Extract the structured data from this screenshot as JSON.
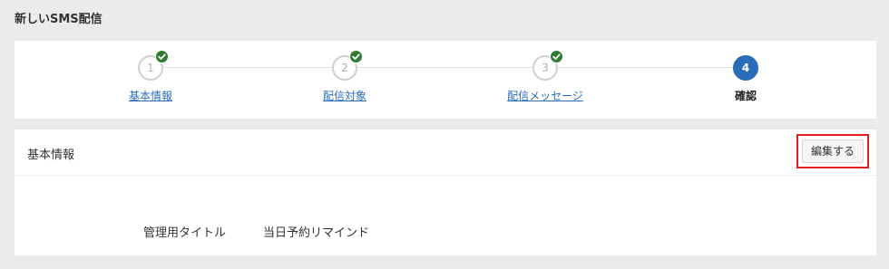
{
  "page": {
    "title": "新しいSMS配信"
  },
  "stepper": {
    "steps": [
      {
        "number": "1",
        "label": "基本情報",
        "completed": true,
        "active": false
      },
      {
        "number": "2",
        "label": "配信対象",
        "completed": true,
        "active": false
      },
      {
        "number": "3",
        "label": "配信メッセージ",
        "completed": true,
        "active": false
      },
      {
        "number": "4",
        "label": "確認",
        "completed": false,
        "active": true
      }
    ]
  },
  "basic_info": {
    "title": "基本情報",
    "edit_label": "編集する",
    "fields": [
      {
        "label": "管理用タイトル",
        "value": "当日予約リマインド"
      }
    ]
  },
  "colors": {
    "accent": "#2b6cb8",
    "check": "#2e7d32",
    "highlight": "#e02020",
    "background": "#ebebeb"
  }
}
